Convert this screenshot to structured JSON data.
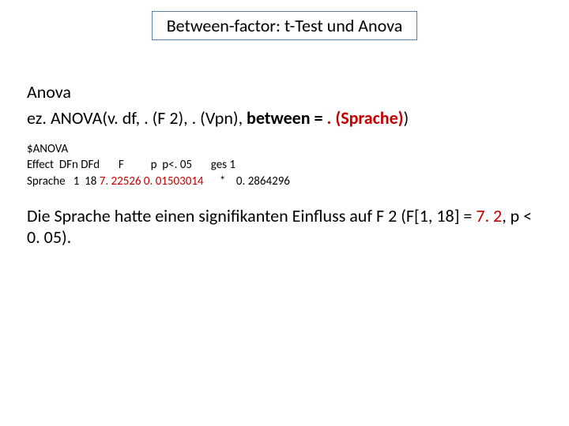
{
  "title": "Between-factor: t-Test und Anova",
  "section": "Anova",
  "code": {
    "prefix": "ez. ANOVA(v. df, . (F 2), . (Vpn), ",
    "between_kw": "between = ",
    "between_val": ". (Sprache)",
    "close": ")"
  },
  "output": {
    "l1": "$ANOVA",
    "l2": "Effect  DFn DFd       F          p  p<. 05       ges 1",
    "l3_prefix": "Sprache   1  18 ",
    "l3_stat": "7. 22526 0. 01503014",
    "l3_suffix": "      *    0. 2864296"
  },
  "conclusion": {
    "part1": "Die Sprache hatte einen signifikanten Einfluss auf F 2 (F[1, 18] = ",
    "fval": "7. 2",
    "part2": ", p < 0. 05).",
    "suffix": ""
  }
}
